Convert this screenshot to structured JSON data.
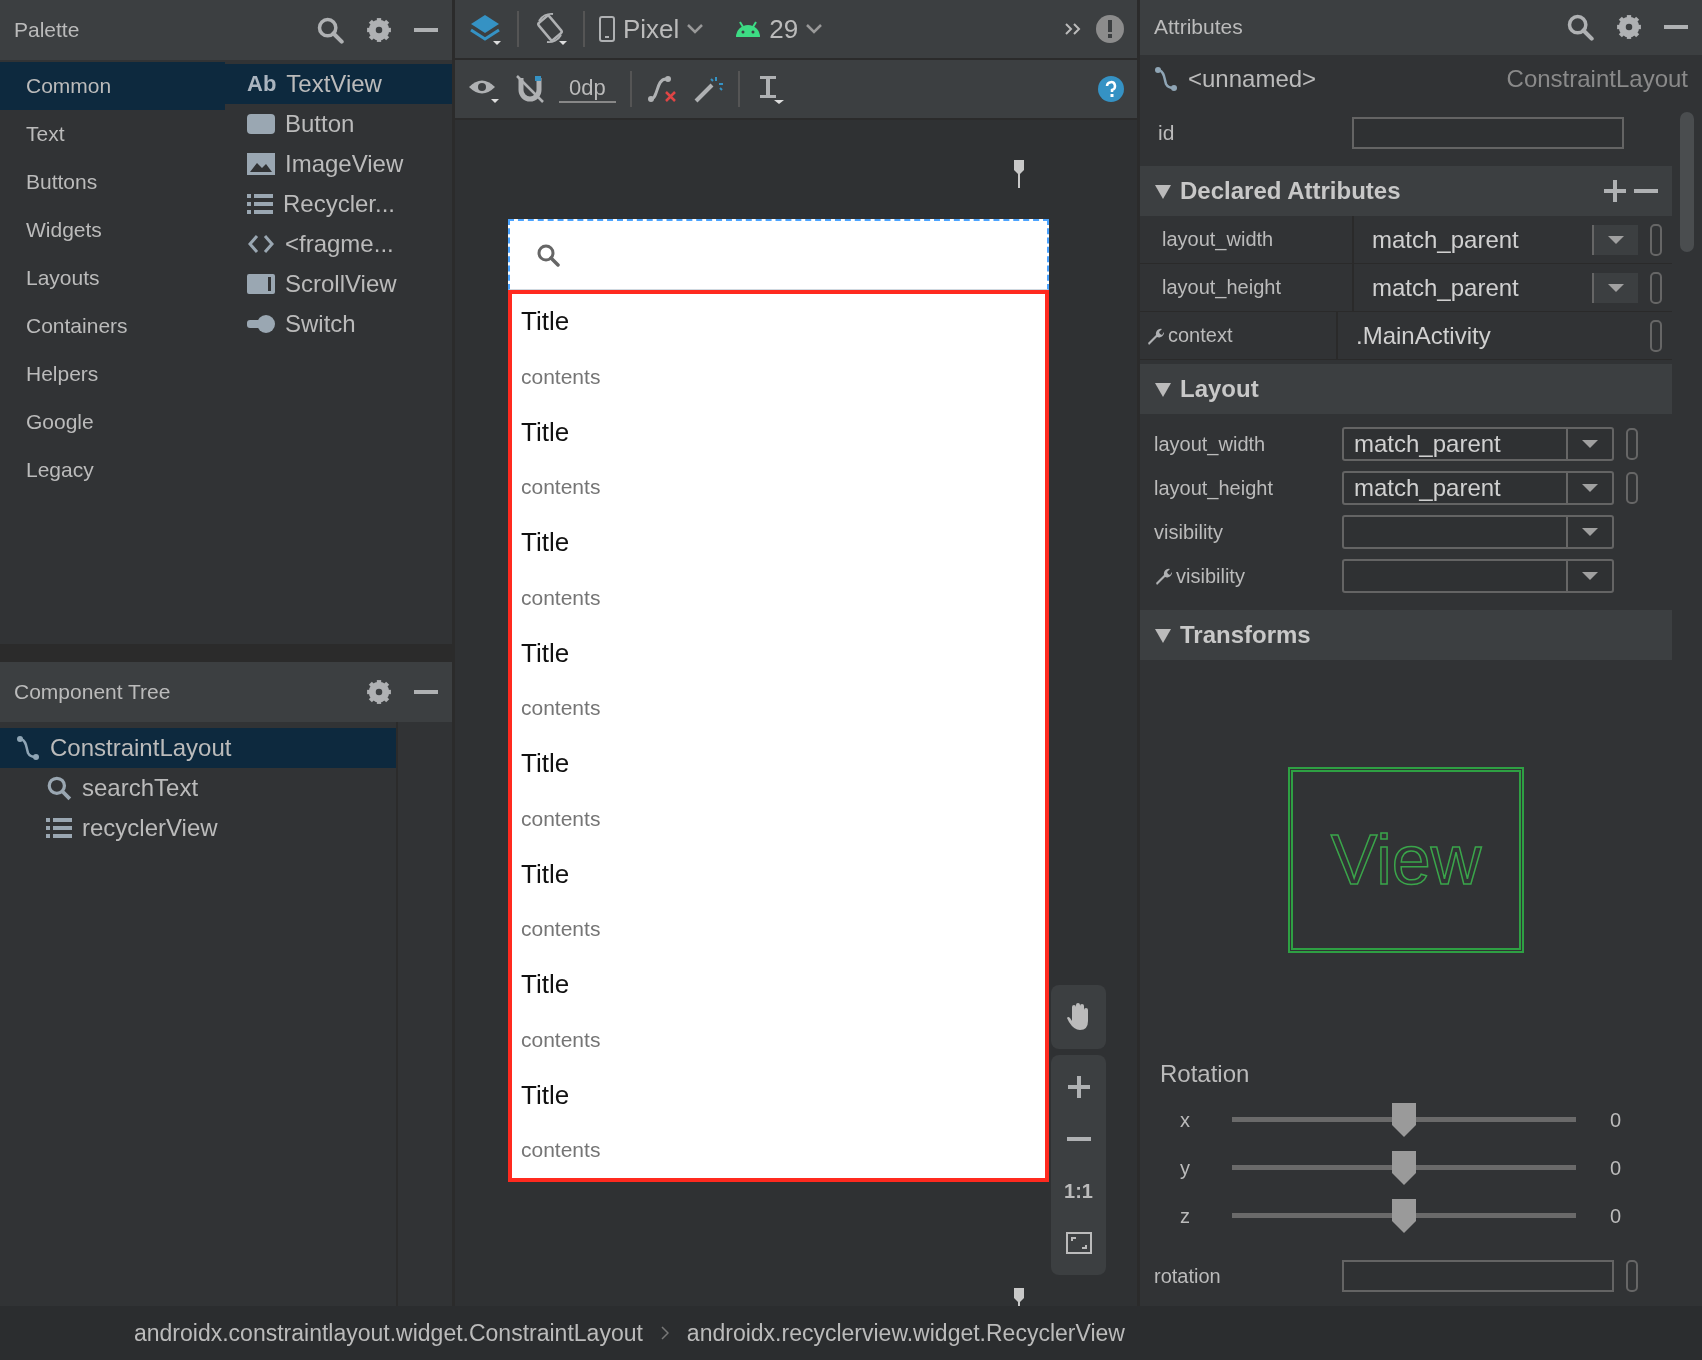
{
  "palette": {
    "title": "Palette",
    "categories": [
      {
        "label": "Common",
        "selected": true
      },
      {
        "label": "Text",
        "selected": false
      },
      {
        "label": "Buttons",
        "selected": false
      },
      {
        "label": "Widgets",
        "selected": false
      },
      {
        "label": "Layouts",
        "selected": false
      },
      {
        "label": "Containers",
        "selected": false
      },
      {
        "label": "Helpers",
        "selected": false
      },
      {
        "label": "Google",
        "selected": false
      },
      {
        "label": "Legacy",
        "selected": false
      }
    ],
    "widgets": [
      {
        "label": "TextView",
        "kind": "text",
        "glyph": "Ab",
        "selected": true
      },
      {
        "label": "Button",
        "kind": "button",
        "selected": false
      },
      {
        "label": "ImageView",
        "kind": "image",
        "selected": false
      },
      {
        "label": "Recycler...",
        "kind": "list",
        "selected": false
      },
      {
        "label": "<fragme...",
        "kind": "fragment",
        "selected": false
      },
      {
        "label": "ScrollView",
        "kind": "scroll",
        "selected": false
      },
      {
        "label": "Switch",
        "kind": "switch",
        "selected": false
      }
    ]
  },
  "component_tree": {
    "title": "Component Tree",
    "items": [
      {
        "label": "ConstraintLayout",
        "kind": "constraint",
        "selected": true,
        "children": [
          {
            "label": "searchText",
            "kind": "search",
            "selected": false
          },
          {
            "label": "recyclerView",
            "kind": "list",
            "selected": false
          }
        ]
      }
    ]
  },
  "toolbar": {
    "device": "Pixel",
    "api": "29",
    "default_margin": "0dp"
  },
  "preview": {
    "items": [
      {
        "title": "Title",
        "content": "contents"
      },
      {
        "title": "Title",
        "content": "contents"
      },
      {
        "title": "Title",
        "content": "contents"
      },
      {
        "title": "Title",
        "content": "contents"
      },
      {
        "title": "Title",
        "content": "contents"
      },
      {
        "title": "Title",
        "content": "contents"
      },
      {
        "title": "Title",
        "content": "contents"
      },
      {
        "title": "Title",
        "content": "contents"
      }
    ],
    "zoom_actual": "1:1"
  },
  "attributes": {
    "title": "Attributes",
    "component_name": "<unnamed>",
    "component_type": "ConstraintLayout",
    "id_label": "id",
    "sections": [
      {
        "title": "Declared Attributes",
        "expanded": true,
        "kind": "declared",
        "rows": [
          {
            "name": "layout_width",
            "value": "match_parent",
            "kind": "dropdown",
            "tools": false
          },
          {
            "name": "layout_height",
            "value": "match_parent",
            "kind": "dropdown",
            "tools": false
          },
          {
            "name": "context",
            "value": ".MainActivity",
            "kind": "text",
            "tools": true
          }
        ]
      },
      {
        "title": "Layout",
        "expanded": true,
        "kind": "layout",
        "rows": [
          {
            "name": "layout_width",
            "value": "match_parent",
            "kind": "dropdown",
            "tools": false
          },
          {
            "name": "layout_height",
            "value": "match_parent",
            "kind": "dropdown",
            "tools": false
          },
          {
            "name": "visibility",
            "kind": "dropdown",
            "tools": false
          },
          {
            "name": "visibility",
            "kind": "dropdown",
            "tools": true
          }
        ]
      },
      {
        "title": "Transforms",
        "expanded": true,
        "kind": "transforms",
        "preview_label": "View",
        "rotation_title": "Rotation",
        "axes": [
          {
            "name": "x",
            "level": 0.5,
            "reading": "0"
          },
          {
            "name": "y",
            "level": 0.5,
            "reading": "0"
          },
          {
            "name": "z",
            "level": 0.5,
            "reading": "0"
          }
        ],
        "rows": [
          {
            "name": "rotation"
          }
        ]
      }
    ]
  },
  "status_bar": {
    "breadcrumbs": [
      "androidx.constraintlayout.widget.ConstraintLayout",
      "androidx.recyclerview.widget.RecyclerView"
    ]
  }
}
